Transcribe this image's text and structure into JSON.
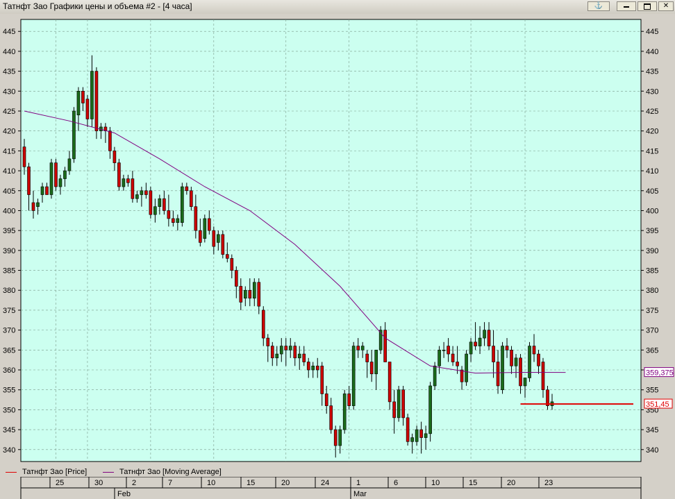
{
  "window": {
    "title": "Татнфт Зао Графики цены и объема #2 - [4 часа]",
    "anchor_icon": "anchor-icon",
    "min_icon": "minimize-icon",
    "max_icon": "maximize-icon",
    "close_icon": "close-icon"
  },
  "legend": {
    "price_label": "Татнфт Зао [Price]",
    "ma_label": "Татнфт Зао [Moving Average]",
    "price_color": "#e00000",
    "ma_color": "#800080"
  },
  "chart_data": {
    "type": "candlestick",
    "ylim": [
      337,
      448
    ],
    "yticks": [
      340,
      345,
      350,
      355,
      360,
      365,
      370,
      375,
      380,
      385,
      390,
      395,
      400,
      405,
      410,
      415,
      420,
      425,
      430,
      435,
      440,
      445
    ],
    "grid": true,
    "up_color": "#1a6b1a",
    "down_color": "#cc0000",
    "background": "#ccfff0",
    "ma_value_label": "359,375",
    "last_price_label": "351,45",
    "last_price": 351.45,
    "ma_last": 359.375,
    "date_ticks": [
      "25",
      "30",
      "2",
      "7",
      "10",
      "15",
      "20",
      "24",
      "1",
      "6",
      "10",
      "15",
      "20",
      "23"
    ],
    "month_labels": [
      "Feb",
      "Mar"
    ],
    "candles": [
      [
        416,
        418,
        409,
        411
      ],
      [
        411,
        412,
        400,
        404
      ],
      [
        402,
        405,
        398,
        400
      ],
      [
        401,
        403,
        399,
        402
      ],
      [
        404,
        407,
        402,
        406
      ],
      [
        406,
        407,
        404,
        404
      ],
      [
        404,
        413,
        403,
        412
      ],
      [
        412,
        413,
        405,
        406
      ],
      [
        406,
        409,
        404,
        408
      ],
      [
        408,
        411,
        406,
        410
      ],
      [
        410,
        415,
        409,
        413
      ],
      [
        413,
        426,
        412,
        425
      ],
      [
        424,
        431,
        420,
        430
      ],
      [
        430,
        431,
        425,
        427
      ],
      [
        428,
        429,
        421,
        423
      ],
      [
        423,
        439,
        421,
        435
      ],
      [
        435,
        436,
        418,
        420
      ],
      [
        420,
        422,
        418,
        421
      ],
      [
        421,
        422,
        417,
        420
      ],
      [
        420,
        421,
        413,
        415
      ],
      [
        415,
        416,
        410,
        412
      ],
      [
        412,
        413,
        405,
        406
      ],
      [
        406,
        409,
        405,
        408
      ],
      [
        408,
        409,
        406,
        407
      ],
      [
        408,
        410,
        402,
        403
      ],
      [
        403,
        405,
        402,
        404
      ],
      [
        404,
        406,
        401,
        405
      ],
      [
        405,
        407,
        403,
        404
      ],
      [
        405,
        406,
        398,
        399
      ],
      [
        399,
        403,
        397,
        401
      ],
      [
        401,
        404,
        399,
        403
      ],
      [
        403,
        405,
        399,
        400
      ],
      [
        400,
        404,
        396,
        398
      ],
      [
        398,
        400,
        396,
        397
      ],
      [
        397,
        399,
        395,
        398
      ],
      [
        397,
        407,
        396,
        406
      ],
      [
        406,
        407,
        404,
        405
      ],
      [
        405,
        406,
        400,
        401
      ],
      [
        401,
        404,
        393,
        395
      ],
      [
        395,
        398,
        391,
        392
      ],
      [
        393,
        399,
        392,
        398
      ],
      [
        398,
        400,
        394,
        395
      ],
      [
        395,
        396,
        389,
        391
      ],
      [
        392,
        395,
        390,
        394
      ],
      [
        394,
        395,
        388,
        389
      ],
      [
        389,
        392,
        387,
        388
      ],
      [
        388,
        389,
        383,
        385
      ],
      [
        385,
        386,
        378,
        381
      ],
      [
        381,
        383,
        375,
        377
      ],
      [
        378,
        381,
        376,
        380
      ],
      [
        380,
        383,
        376,
        378
      ],
      [
        378,
        383,
        376,
        382
      ],
      [
        382,
        383,
        374,
        376
      ],
      [
        375,
        376,
        366,
        368
      ],
      [
        368,
        369,
        362,
        366
      ],
      [
        366,
        367,
        361,
        363
      ],
      [
        363,
        366,
        361,
        364
      ],
      [
        364,
        368,
        362,
        366
      ],
      [
        366,
        368,
        361,
        365
      ],
      [
        365,
        368,
        363,
        366
      ],
      [
        366,
        367,
        361,
        363
      ],
      [
        363,
        366,
        360,
        364
      ],
      [
        364,
        366,
        361,
        362
      ],
      [
        362,
        363,
        358,
        360
      ],
      [
        360,
        362,
        358,
        361
      ],
      [
        361,
        363,
        358,
        360
      ],
      [
        361,
        362,
        351,
        354
      ],
      [
        354,
        356,
        349,
        351
      ],
      [
        351,
        353,
        344,
        345
      ],
      [
        345,
        346,
        338,
        341
      ],
      [
        341,
        346,
        339,
        345
      ],
      [
        345,
        355,
        344,
        354
      ],
      [
        354,
        356,
        350,
        351
      ],
      [
        351,
        367,
        350,
        366
      ],
      [
        366,
        368,
        363,
        365
      ],
      [
        365,
        367,
        363,
        366
      ],
      [
        364,
        365,
        358,
        362
      ],
      [
        362,
        365,
        357,
        359
      ],
      [
        359,
        363,
        355,
        365
      ],
      [
        365,
        371,
        364,
        370
      ],
      [
        370,
        372,
        362,
        362
      ],
      [
        362,
        362,
        350,
        352
      ],
      [
        352,
        355,
        344,
        348
      ],
      [
        348,
        356,
        347,
        355
      ],
      [
        355,
        356,
        346,
        348
      ],
      [
        348,
        349,
        341,
        342
      ],
      [
        342,
        344,
        339,
        343
      ],
      [
        342,
        346,
        341,
        345
      ],
      [
        345,
        347,
        339,
        343
      ],
      [
        343,
        346,
        340,
        344
      ],
      [
        344,
        357,
        342,
        356
      ],
      [
        356,
        362,
        355,
        361
      ],
      [
        361,
        366,
        359,
        365
      ],
      [
        365,
        367,
        363,
        365
      ],
      [
        366,
        368,
        362,
        364
      ],
      [
        364,
        366,
        361,
        362
      ],
      [
        362,
        366,
        359,
        361
      ],
      [
        360,
        361,
        355,
        357
      ],
      [
        357,
        365,
        356,
        364
      ],
      [
        364,
        368,
        362,
        367
      ],
      [
        367,
        372,
        365,
        366
      ],
      [
        366,
        371,
        364,
        368
      ],
      [
        368,
        372,
        366,
        370
      ],
      [
        370,
        372,
        365,
        366
      ],
      [
        366,
        370,
        358,
        362
      ],
      [
        362,
        365,
        354,
        356
      ],
      [
        355,
        367,
        354,
        366
      ],
      [
        366,
        368,
        363,
        365
      ],
      [
        365,
        366,
        359,
        361
      ],
      [
        361,
        364,
        358,
        363
      ],
      [
        363,
        364,
        354,
        356
      ],
      [
        356,
        358,
        353,
        358
      ],
      [
        358,
        367,
        357,
        366
      ],
      [
        366,
        369,
        362,
        364
      ],
      [
        364,
        365,
        359,
        361
      ],
      [
        362,
        363,
        353,
        355
      ],
      [
        355,
        356,
        350,
        351
      ],
      [
        351,
        354,
        350,
        352
      ]
    ],
    "moving_average": [
      [
        0,
        425
      ],
      [
        10,
        422.5
      ],
      [
        20,
        419.5
      ],
      [
        30,
        413
      ],
      [
        40,
        406
      ],
      [
        50,
        400
      ],
      [
        60,
        391.5
      ],
      [
        70,
        381
      ],
      [
        80,
        368
      ],
      [
        90,
        361
      ],
      [
        100,
        359.2
      ],
      [
        110,
        359.4
      ],
      [
        120,
        359.375
      ]
    ]
  }
}
